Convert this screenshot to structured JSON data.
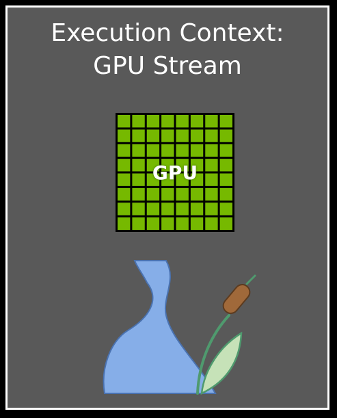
{
  "title": {
    "line1": "Execution Context:",
    "line2": "GPU Stream"
  },
  "gpu": {
    "label": "GPU",
    "grid_cols": 8,
    "grid_rows": 8,
    "cell_color": "#76b900",
    "grid_line_color": "#000000"
  },
  "stream": {
    "water_color": "#86aee8",
    "water_edge_color": "#4a72b0",
    "cattail_head_color": "#a0693a",
    "stem_color": "#4f9a6e",
    "leaf_color": "#c6e2b8"
  },
  "colors": {
    "background": "#000000",
    "panel": "#595959",
    "border": "#ffffff"
  }
}
